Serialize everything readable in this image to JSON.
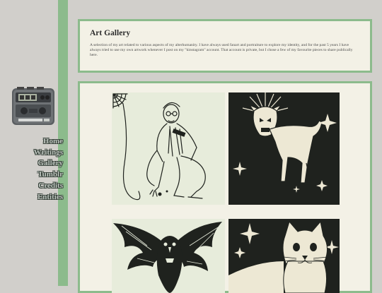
{
  "nav": {
    "items": [
      {
        "label": "Home"
      },
      {
        "label": "Writings"
      },
      {
        "label": "Gallery"
      },
      {
        "label": "Tumblr"
      },
      {
        "label": "Credits"
      },
      {
        "label": "Entities"
      }
    ]
  },
  "header": {
    "title": "Art Gallery",
    "description": "A selection of my art related to various aspects of my alterhumanity. I have always used fanart and portraiture to explore my identity, and for the past 5 years I have always tried to use my own artwork whenever I post on my \"kinstagram\" account. That account is private, but I chose a few of my favourite pieces to share publically here."
  },
  "gallery": {
    "artworks": [
      {
        "subject": "man with glasses crouching beside a spiderweb",
        "style": "ink on pale green"
      },
      {
        "subject": "horned goat with starburst halo",
        "style": "black background, cream linework"
      },
      {
        "subject": "winged raven figure",
        "style": "black linework on pale green"
      },
      {
        "subject": "white cat with sparkles",
        "style": "black background, cream linework"
      }
    ]
  },
  "colors": {
    "background": "#d1cfcb",
    "accent_green": "#8cbb8c",
    "panel": "#f3f1e6",
    "tile_light": "#e7ecdb",
    "tile_dark": "#1f221e"
  }
}
